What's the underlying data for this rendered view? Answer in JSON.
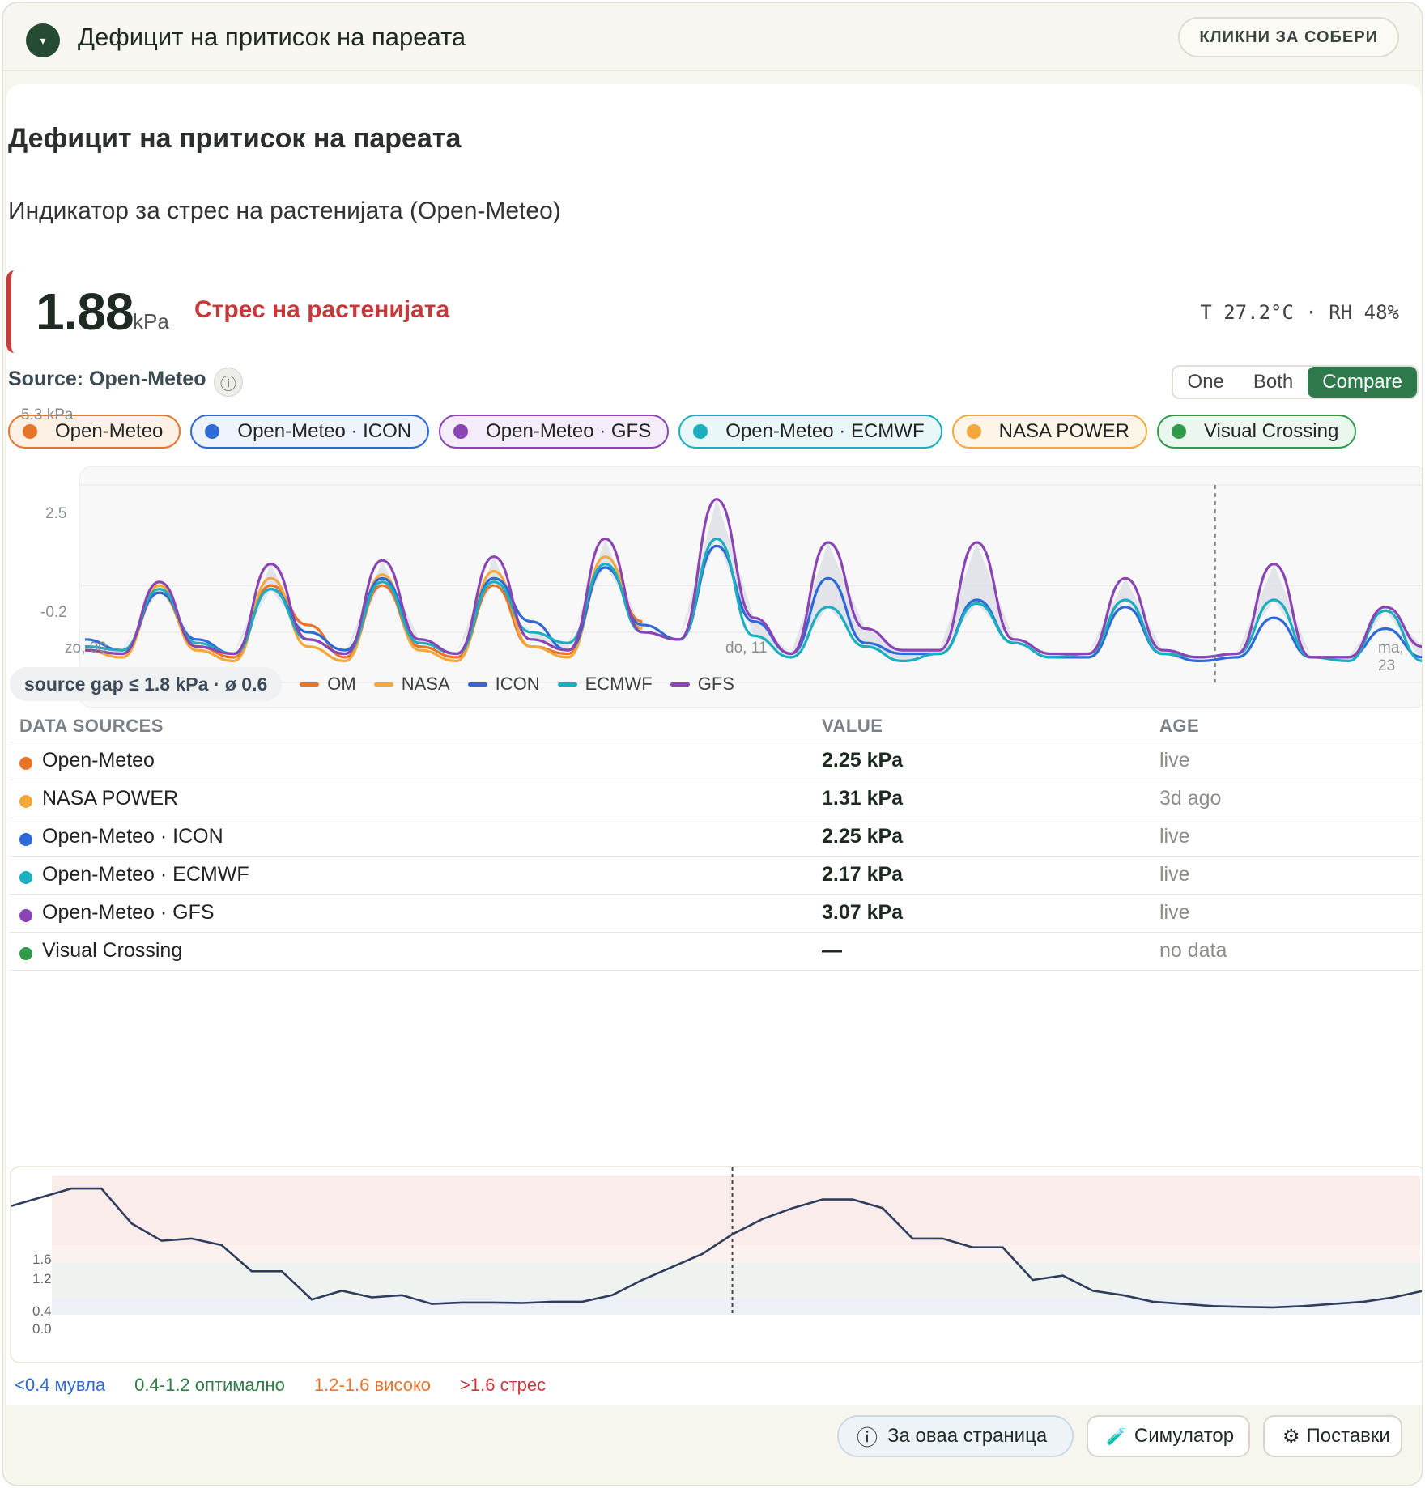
{
  "header": {
    "toggle_icon": "▾",
    "title": "Дефицит на притисок на пареата",
    "collapse_label": "КЛИКНИ ЗА СОБЕРИ"
  },
  "card": {
    "title": "Дефицит на притисок на пареата",
    "subtitle": "Индикатор за стрес на растенијата (Open-Meteo)",
    "metric": {
      "value": "1.88",
      "unit": "kPa",
      "status": "Стрес на растенијата",
      "status_color": "#c8383a",
      "conditions": "T 27.2°C · RH 48%"
    },
    "source_label": "Source: Open-Meteo",
    "info_icon": "ⓘ",
    "mode": {
      "options": [
        "One",
        "Both",
        "Compare"
      ],
      "selected": "Compare"
    },
    "chips": [
      {
        "label": "Open-Meteo",
        "color": "#e8742a",
        "bg": "#fdf1e6"
      },
      {
        "label": "Open-Meteo · ICON",
        "color": "#2d6ad6",
        "bg": "#eef3fc"
      },
      {
        "label": "Open-Meteo · GFS",
        "color": "#8a44b4",
        "bg": "#f4ecf8"
      },
      {
        "label": "Open-Meteo · ECMWF",
        "color": "#1aaebf",
        "bg": "#e9f7f8"
      },
      {
        "label": "NASA POWER",
        "color": "#f2a83a",
        "bg": "#fdf5e8"
      },
      {
        "label": "Visual Crossing",
        "color": "#2f9a4a",
        "bg": "#ebf6ee"
      }
    ],
    "gap_summary": "source gap ≤ 1.8 kPa · ø 0.6",
    "legend": [
      {
        "label": "OM",
        "color": "#e8742a"
      },
      {
        "label": "NASA",
        "color": "#f2a83a"
      },
      {
        "label": "ICON",
        "color": "#2d6ad6"
      },
      {
        "label": "ECMWF",
        "color": "#1aaebf"
      },
      {
        "label": "GFS",
        "color": "#8a44b4"
      }
    ],
    "table": {
      "headers": {
        "source": "DATA SOURCES",
        "value": "VALUE",
        "age": "AGE"
      },
      "rows": [
        {
          "name": "Open-Meteo",
          "value": "2.25 kPa",
          "age": "live",
          "color": "#e8742a"
        },
        {
          "name": "NASA POWER",
          "value": "1.31 kPa",
          "age": "3d ago",
          "color": "#f2a83a"
        },
        {
          "name": "Open-Meteo · ICON",
          "value": "2.25 kPa",
          "age": "live",
          "color": "#2d6ad6"
        },
        {
          "name": "Open-Meteo · ECMWF",
          "value": "2.17 kPa",
          "age": "live",
          "color": "#1aaebf"
        },
        {
          "name": "Open-Meteo · GFS",
          "value": "3.07 kPa",
          "age": "live",
          "color": "#8a44b4"
        },
        {
          "name": "Visual Crossing",
          "value": "—",
          "age": "no data",
          "color": "#2f9a4a"
        }
      ]
    },
    "zones": [
      {
        "label": "<0.4 мувла",
        "color": "#2d6ad6"
      },
      {
        "label": "0.4-1.2 оптимално",
        "color": "#2f7d47"
      },
      {
        "label": "1.2-1.6 високо",
        "color": "#e8742a"
      },
      {
        "label": ">1.6 стрес",
        "color": "#c8383a"
      }
    ]
  },
  "footer": {
    "about_label": "За оваа страница",
    "about_icon": "ⓘ",
    "simulator_label": "Симулатор",
    "simulator_icon": "🧪",
    "settings_label": "Поставки",
    "settings_icon": "⚙"
  },
  "chart_data": [
    {
      "type": "line",
      "ylabel": "kPa",
      "ytick_labels": [
        "5.3 kPa",
        "2.5",
        "-0.2"
      ],
      "ylim": [
        -0.2,
        5.3
      ],
      "xtick_labels": [
        "zo, 00",
        "do, 11",
        "ma, 23"
      ],
      "now_marker": true,
      "x_hours": [
        0,
        12,
        24,
        36,
        48,
        60,
        72,
        84,
        96,
        108,
        120,
        132,
        144,
        156,
        168,
        180,
        192,
        204,
        216,
        228,
        240,
        252,
        264,
        276,
        288,
        300,
        312,
        324,
        336,
        348,
        360,
        372,
        384,
        396,
        408,
        420,
        432
      ],
      "series": [
        {
          "name": "OM",
          "color": "#e8742a",
          "values": [
            0.7,
            0.6,
            2.3,
            0.8,
            0.5,
            2.5,
            1.4,
            0.5,
            2.5,
            0.8,
            0.5,
            2.5,
            0.8,
            0.6,
            3.0,
            1.5,
            null,
            null,
            null,
            null,
            null,
            null,
            null,
            null,
            null,
            null,
            null,
            null,
            null,
            null,
            null,
            null,
            null,
            null,
            null,
            null,
            null
          ]
        },
        {
          "name": "NASA",
          "color": "#f2a83a",
          "values": [
            0.7,
            0.5,
            2.5,
            0.7,
            0.4,
            2.7,
            0.8,
            0.4,
            2.8,
            0.7,
            0.4,
            2.9,
            0.8,
            0.5,
            3.3,
            1.3,
            null,
            null,
            null,
            null,
            null,
            null,
            null,
            null,
            null,
            null,
            null,
            null,
            null,
            null,
            null,
            null,
            null,
            null,
            null,
            null,
            null
          ]
        },
        {
          "name": "ICON",
          "color": "#2d6ad6",
          "values": [
            1.0,
            0.7,
            2.3,
            1.0,
            0.6,
            2.4,
            1.2,
            0.7,
            2.7,
            1.0,
            0.6,
            2.7,
            1.5,
            0.7,
            3.0,
            1.4,
            1.0,
            3.6,
            1.5,
            0.6,
            2.7,
            0.9,
            0.6,
            0.6,
            2.1,
            0.9,
            0.5,
            0.5,
            1.9,
            0.6,
            0.4,
            0.5,
            1.6,
            0.5,
            0.5,
            1.3,
            0.5
          ]
        },
        {
          "name": "ECMWF",
          "color": "#1aaebf",
          "values": [
            0.8,
            0.7,
            2.4,
            0.9,
            0.6,
            2.4,
            1.0,
            0.6,
            2.6,
            0.9,
            0.6,
            2.6,
            1.2,
            0.9,
            3.1,
            1.2,
            1.0,
            3.8,
            1.1,
            0.5,
            1.9,
            0.8,
            0.4,
            0.6,
            2.0,
            0.9,
            0.5,
            0.6,
            2.1,
            0.6,
            0.5,
            0.6,
            2.1,
            0.5,
            0.4,
            1.8,
            0.4
          ]
        },
        {
          "name": "GFS",
          "color": "#8a44b4",
          "values": [
            0.7,
            0.6,
            2.6,
            0.8,
            0.6,
            3.1,
            1.0,
            0.6,
            3.2,
            1.0,
            0.6,
            3.3,
            1.0,
            0.7,
            3.8,
            1.2,
            1.0,
            4.9,
            1.6,
            0.6,
            3.7,
            1.3,
            0.7,
            0.7,
            3.7,
            1.0,
            0.6,
            0.6,
            2.7,
            0.7,
            0.5,
            0.6,
            3.1,
            0.5,
            0.5,
            1.9,
            0.8
          ]
        }
      ]
    },
    {
      "type": "line",
      "ytick_labels": [
        "1.6",
        "1.2",
        "0.4",
        "0.0"
      ],
      "ylim": [
        0,
        3.2
      ],
      "bands": [
        {
          "from": 0,
          "to": 0.4,
          "color": "#eef0f7"
        },
        {
          "from": 0.4,
          "to": 1.2,
          "color": "#eef3ef"
        },
        {
          "from": 1.2,
          "to": 1.6,
          "color": "#fbf1ee"
        },
        {
          "from": 1.6,
          "to": 3.2,
          "color": "#faeceb"
        }
      ],
      "now_index": 24,
      "values": [
        2.5,
        2.7,
        2.9,
        2.9,
        2.1,
        1.7,
        1.75,
        1.6,
        1.0,
        1.0,
        0.35,
        0.55,
        0.4,
        0.45,
        0.25,
        0.28,
        0.28,
        0.27,
        0.3,
        0.3,
        0.45,
        0.8,
        1.1,
        1.4,
        1.85,
        2.2,
        2.45,
        2.65,
        2.65,
        2.45,
        1.75,
        1.75,
        1.55,
        1.55,
        0.8,
        0.9,
        0.55,
        0.45,
        0.3,
        0.25,
        0.2,
        0.18,
        0.17,
        0.2,
        0.25,
        0.3,
        0.4,
        0.55
      ]
    }
  ]
}
